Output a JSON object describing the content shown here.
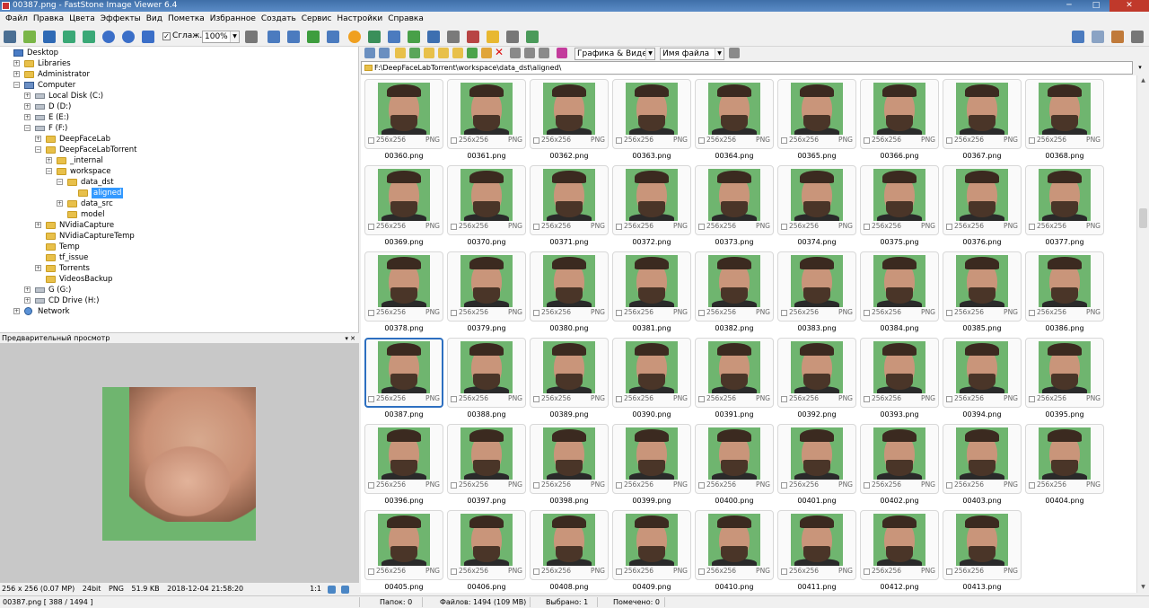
{
  "window": {
    "title": "00387.png - FastStone Image Viewer 6.4",
    "minimize": "─",
    "maximize": "□",
    "close": "✕"
  },
  "menu": [
    "Файл",
    "Правка",
    "Цвета",
    "Эффекты",
    "Вид",
    "Пометка",
    "Избранное",
    "Создать",
    "Сервис",
    "Настройки",
    "Справка"
  ],
  "toolbar": {
    "smooth_label": "Сглаж.",
    "smooth_checked": "✓",
    "zoom_value": "100%",
    "filter_value": "Графика & Видео",
    "sort_value": "Имя файла"
  },
  "tree": [
    {
      "label": "Desktop",
      "depth": 0,
      "icon": "desk",
      "exp": ""
    },
    {
      "label": "Libraries",
      "depth": 1,
      "icon": "folder",
      "exp": "+"
    },
    {
      "label": "Administrator",
      "depth": 1,
      "icon": "folder",
      "exp": "+"
    },
    {
      "label": "Computer",
      "depth": 1,
      "icon": "comp",
      "exp": "−"
    },
    {
      "label": "Local Disk (C:)",
      "depth": 2,
      "icon": "drive",
      "exp": "+"
    },
    {
      "label": "D (D:)",
      "depth": 2,
      "icon": "drive",
      "exp": "+"
    },
    {
      "label": "E (E:)",
      "depth": 2,
      "icon": "drive",
      "exp": "+"
    },
    {
      "label": "F (F:)",
      "depth": 2,
      "icon": "drive",
      "exp": "−"
    },
    {
      "label": "DeepFaceLab",
      "depth": 3,
      "icon": "folder",
      "exp": "+"
    },
    {
      "label": "DeepFaceLabTorrent",
      "depth": 3,
      "icon": "folder",
      "exp": "−"
    },
    {
      "label": "_internal",
      "depth": 4,
      "icon": "folder",
      "exp": "+"
    },
    {
      "label": "workspace",
      "depth": 4,
      "icon": "folder",
      "exp": "−"
    },
    {
      "label": "data_dst",
      "depth": 5,
      "icon": "folder",
      "exp": "−"
    },
    {
      "label": "aligned",
      "depth": 6,
      "icon": "folder",
      "exp": "",
      "selected": true
    },
    {
      "label": "data_src",
      "depth": 5,
      "icon": "folder",
      "exp": "+"
    },
    {
      "label": "model",
      "depth": 5,
      "icon": "folder",
      "exp": ""
    },
    {
      "label": "NVidiaCapture",
      "depth": 3,
      "icon": "folder",
      "exp": "+"
    },
    {
      "label": "NVidiaCaptureTemp",
      "depth": 3,
      "icon": "folder",
      "exp": ""
    },
    {
      "label": "Temp",
      "depth": 3,
      "icon": "folder",
      "exp": ""
    },
    {
      "label": "tf_issue",
      "depth": 3,
      "icon": "folder",
      "exp": ""
    },
    {
      "label": "Torrents",
      "depth": 3,
      "icon": "folder",
      "exp": "+"
    },
    {
      "label": "VideosBackup",
      "depth": 3,
      "icon": "folder",
      "exp": ""
    },
    {
      "label": "G (G:)",
      "depth": 2,
      "icon": "drive",
      "exp": "+"
    },
    {
      "label": "CD Drive (H:)",
      "depth": 2,
      "icon": "drive",
      "exp": "+"
    },
    {
      "label": "Network",
      "depth": 1,
      "icon": "net",
      "exp": "+"
    }
  ],
  "preview": {
    "header": "Предварительный просмотр",
    "pin": "▾ ✕",
    "status_dims": "256 x 256 (0.07 MP)",
    "status_bits": "24bit",
    "status_fmt": "PNG",
    "status_size": "51.9 KB",
    "status_date": "2018-12-04 21:58:20",
    "zoom": "1:1"
  },
  "path": "F:\\DeepFaceLabTorrent\\workspace\\data_dst\\aligned\\",
  "path_arrow": "▾",
  "thumb_dims": "256x256",
  "thumb_fmt": "PNG",
  "files": [
    "00360.png",
    "00361.png",
    "00362.png",
    "00363.png",
    "00364.png",
    "00365.png",
    "00366.png",
    "00367.png",
    "00368.png",
    "00369.png",
    "00370.png",
    "00371.png",
    "00372.png",
    "00373.png",
    "00374.png",
    "00375.png",
    "00376.png",
    "00377.png",
    "00378.png",
    "00379.png",
    "00380.png",
    "00381.png",
    "00382.png",
    "00383.png",
    "00384.png",
    "00385.png",
    "00386.png",
    "00387.png",
    "00388.png",
    "00389.png",
    "00390.png",
    "00391.png",
    "00392.png",
    "00393.png",
    "00394.png",
    "00395.png",
    "00396.png",
    "00397.png",
    "00398.png",
    "00399.png",
    "00400.png",
    "00401.png",
    "00402.png",
    "00403.png",
    "00404.png",
    "00405.png",
    "00406.png",
    "00408.png",
    "00409.png",
    "00410.png",
    "00411.png",
    "00412.png",
    "00413.png"
  ],
  "selected_file": "00387.png",
  "status": {
    "current": "00387.png [ 388 / 1494 ]",
    "folders": "Папок: 0",
    "files": "Файлов: 1494 (109 MB)",
    "selected": "Выбрано: 1",
    "marked": "Помечено: 0"
  },
  "colors": {
    "accent": "#3399ff",
    "selection_border": "#2d6fc0",
    "green_screen": "#6fb56f"
  }
}
